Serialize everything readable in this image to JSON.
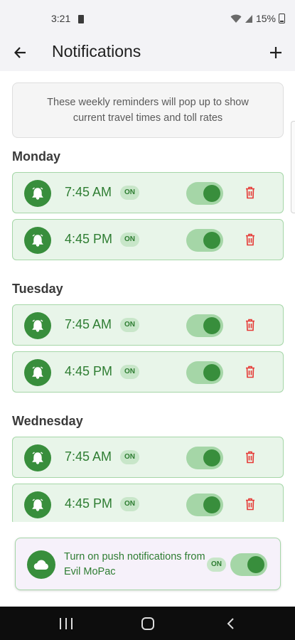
{
  "status_bar": {
    "time": "3:21",
    "battery": "15%"
  },
  "header": {
    "title": "Notifications"
  },
  "info": "These weekly reminders will pop up to show current travel times and toll rates",
  "days": [
    {
      "label": "Monday",
      "reminders": [
        {
          "time": "7:45 AM",
          "badge": "ON",
          "enabled": true
        },
        {
          "time": "4:45 PM",
          "badge": "ON",
          "enabled": true
        }
      ]
    },
    {
      "label": "Tuesday",
      "reminders": [
        {
          "time": "7:45 AM",
          "badge": "ON",
          "enabled": true
        },
        {
          "time": "4:45 PM",
          "badge": "ON",
          "enabled": true
        }
      ]
    },
    {
      "label": "Wednesday",
      "reminders": [
        {
          "time": "7:45 AM",
          "badge": "ON",
          "enabled": true
        },
        {
          "time": "4:45 PM",
          "badge": "ON",
          "enabled": true
        }
      ]
    }
  ],
  "push": {
    "text": "Turn on push notifications from Evil MoPac",
    "badge": "ON",
    "enabled": true
  },
  "colors": {
    "accent": "#388e3c",
    "accent_light": "#a5d6a7",
    "card_bg": "#e8f5e9",
    "delete": "#e53935"
  },
  "icons": {
    "back": "arrow-left-icon",
    "add": "plus-icon",
    "alarm": "alarm-bell-icon",
    "delete": "trash-icon",
    "cloud": "cloud-icon"
  }
}
